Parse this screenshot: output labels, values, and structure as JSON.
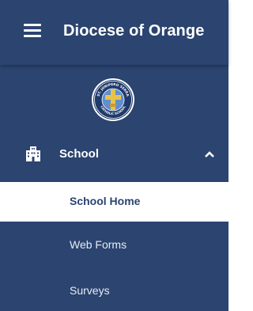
{
  "header": {
    "title": "Diocese of Orange",
    "menu_icon": "hamburger-menu-icon"
  },
  "logo": {
    "icon": "school-seal-logo",
    "seal_text": "ST. JUNIPERO SERRA CATHOLIC SCHOOL"
  },
  "nav": {
    "section": {
      "label": "School",
      "icon": "building-icon",
      "state_icon": "chevron-up-icon",
      "expanded": true
    },
    "items": [
      {
        "label": "School Home",
        "active": true
      },
      {
        "label": "Web Forms",
        "active": false
      },
      {
        "label": "Surveys",
        "active": false
      }
    ]
  },
  "colors": {
    "background": "#2b4470",
    "active_background": "#ffffff",
    "active_text": "#2b4470",
    "seal_gold": "#e7c34a"
  }
}
